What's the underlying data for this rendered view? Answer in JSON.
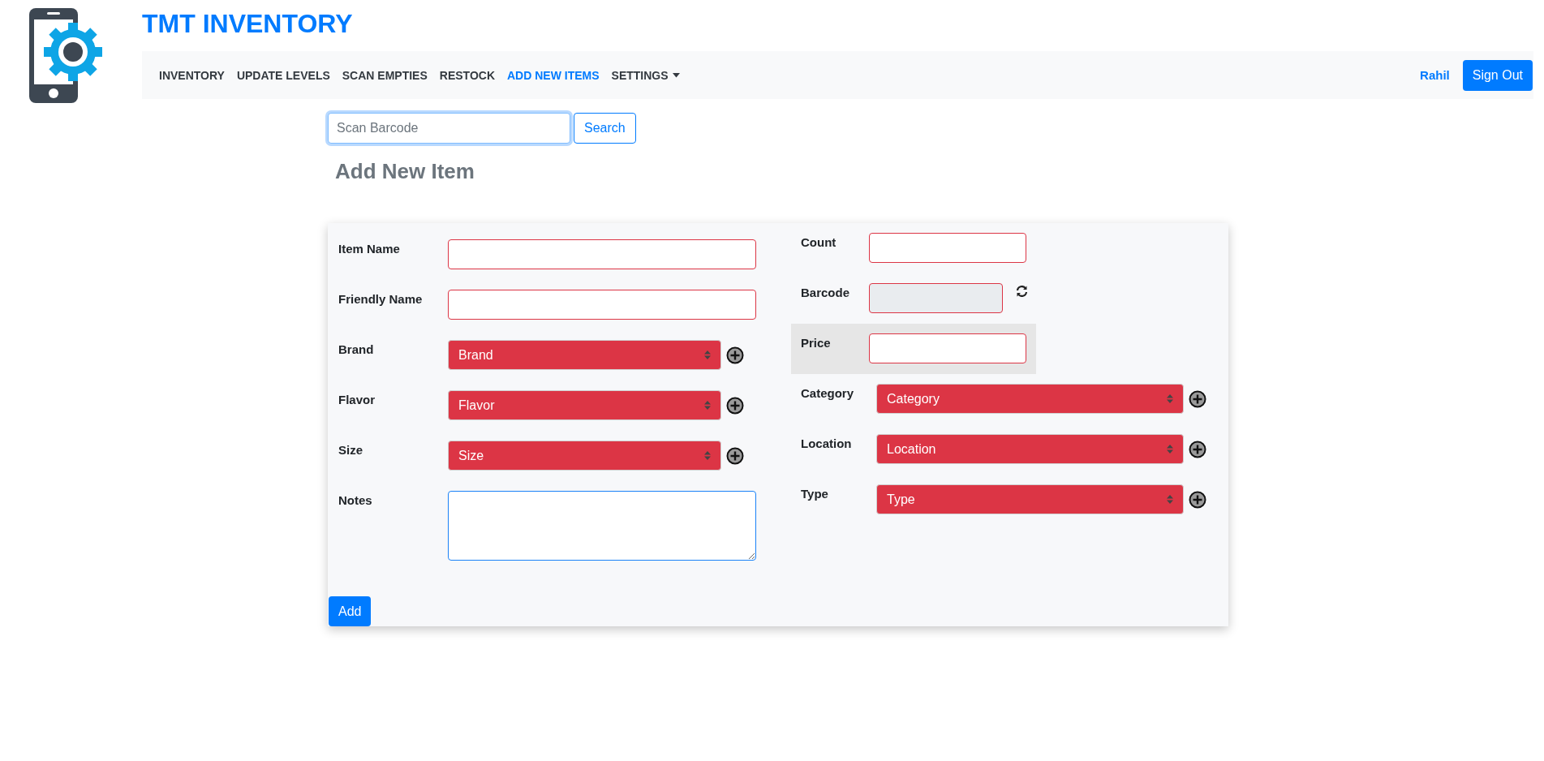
{
  "brand": {
    "title": "TMT INVENTORY"
  },
  "nav": {
    "items": [
      {
        "label": "INVENTORY",
        "selected": false,
        "dropdown": false
      },
      {
        "label": "UPDATE LEVELS",
        "selected": false,
        "dropdown": false
      },
      {
        "label": "SCAN EMPTIES",
        "selected": false,
        "dropdown": false
      },
      {
        "label": "RESTOCK",
        "selected": false,
        "dropdown": false
      },
      {
        "label": "ADD NEW ITEMS",
        "selected": true,
        "dropdown": false
      },
      {
        "label": "SETTINGS",
        "selected": false,
        "dropdown": true
      }
    ],
    "user": "Rahil",
    "sign_out": "Sign Out"
  },
  "search": {
    "placeholder": "Scan Barcode",
    "button": "Search"
  },
  "heading": "Add New Item",
  "form": {
    "left_fields": [
      {
        "label": "Item Name",
        "kind": "input",
        "invalid": true,
        "disabled": false
      },
      {
        "label": "Friendly Name",
        "kind": "input",
        "invalid": true,
        "disabled": false
      },
      {
        "label": "Brand",
        "kind": "select",
        "placeholder": "Brand",
        "invalid": true,
        "add_button": true
      },
      {
        "label": "Flavor",
        "kind": "select",
        "placeholder": "Flavor",
        "invalid": true,
        "add_button": true
      },
      {
        "label": "Size",
        "kind": "select",
        "placeholder": "Size",
        "invalid": true,
        "add_button": true
      },
      {
        "label": "Notes",
        "kind": "textarea",
        "invalid": false
      }
    ],
    "right_fields": [
      {
        "label": "Count",
        "kind": "input",
        "invalid": true,
        "disabled": false,
        "highlighted": false
      },
      {
        "label": "Barcode",
        "kind": "input",
        "invalid": true,
        "disabled": true,
        "refresh_button": true,
        "highlighted": false
      },
      {
        "label": "Price",
        "kind": "input",
        "invalid": true,
        "disabled": false,
        "highlighted": true
      },
      {
        "label": "Category",
        "kind": "select",
        "placeholder": "Category",
        "invalid": true,
        "add_button": true,
        "highlighted": false
      },
      {
        "label": "Location",
        "kind": "select",
        "placeholder": "Location",
        "invalid": true,
        "add_button": true,
        "highlighted": false
      },
      {
        "label": "Type",
        "kind": "select",
        "placeholder": "Type",
        "invalid": true,
        "add_button": true,
        "highlighted": false
      }
    ],
    "submit": "Add"
  }
}
